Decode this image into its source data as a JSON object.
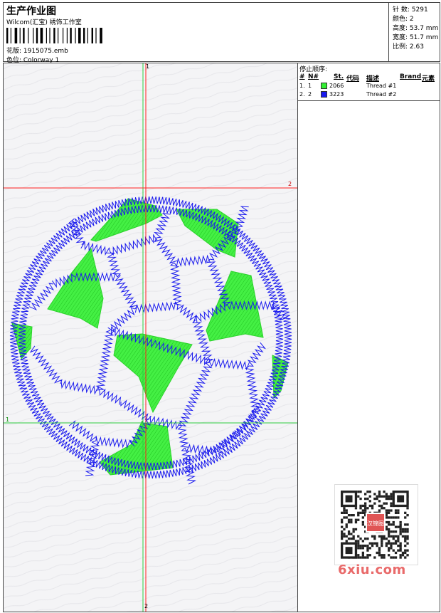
{
  "header": {
    "title": "生产作业图",
    "company": "Wilcom(汇宝) 绣饰工作室",
    "design_file": "花版: 1915075.emb",
    "colorway": "色位: Colorway 1",
    "stats": [
      {
        "label": "针 数: ",
        "value": "5291"
      },
      {
        "label": "颜色: ",
        "value": "2"
      },
      {
        "label": "高度: ",
        "value": "53.7 mm"
      },
      {
        "label": "宽度: ",
        "value": "51.7 mm"
      },
      {
        "label": "比例: ",
        "value": "2.63"
      }
    ]
  },
  "canvas": {
    "guide_labels": {
      "v_top": "1",
      "v_bottom": "2",
      "h_top": "2",
      "h_bottom": "1"
    },
    "guide_colors": {
      "first": "#2ecc40",
      "second": "#ff2020"
    },
    "fill_color": "#33ee33",
    "outline_color": "#1a1aee"
  },
  "panel": {
    "stop_sequence_title": "停止顺序:",
    "columns": [
      "#",
      "N#",
      "St.",
      "代码",
      "描述",
      "Brand",
      "元素"
    ],
    "threads": [
      {
        "num": "1.",
        "needle": "1",
        "color": "#33ee33",
        "code": "2066",
        "desc": "Thread #1"
      },
      {
        "num": "2.",
        "needle": "2",
        "color": "#1a1aee",
        "code": "3223",
        "desc": "Thread #2"
      }
    ]
  },
  "watermark": {
    "text": "6xiu.com",
    "seal_text": "汉锦图"
  }
}
